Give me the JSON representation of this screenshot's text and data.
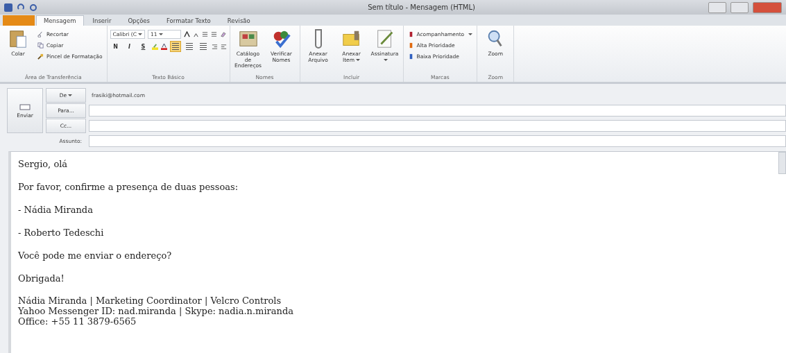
{
  "window": {
    "title": "Sem título - Mensagem (HTML)"
  },
  "tabs": [
    {
      "label": "Mensagem",
      "selected": true
    },
    {
      "label": "Inserir",
      "selected": false
    },
    {
      "label": "Opções",
      "selected": false
    },
    {
      "label": "Formatar Texto",
      "selected": false
    },
    {
      "label": "Revisão",
      "selected": false
    }
  ],
  "ribbon": [
    {
      "kind": "clipboard",
      "label": "Área de Transferência",
      "large": {
        "label": "Colar"
      },
      "small": [
        {
          "label": "Recortar"
        },
        {
          "label": "Copiar"
        },
        {
          "label": "Pincel de Formatação"
        }
      ]
    },
    {
      "kind": "font",
      "label": "Texto Básico",
      "font_name": "Calibri (C",
      "font_size": "11",
      "styles": [
        "N",
        "I",
        "S"
      ],
      "alignment": [
        {
          "selected": true
        },
        {
          "selected": false
        },
        {
          "selected": false
        }
      ]
    },
    {
      "kind": "large",
      "label": "Nomes",
      "buttons": [
        {
          "label": "Catálogo de Endereços",
          "dropdown": false
        },
        {
          "label": "Verificar Nomes",
          "dropdown": false
        }
      ]
    },
    {
      "kind": "large",
      "label": "Incluir",
      "buttons": [
        {
          "label": "Anexar Arquivo",
          "dropdown": false
        },
        {
          "label": "Anexar Item",
          "dropdown": true
        },
        {
          "label": "Assinatura",
          "dropdown": true
        }
      ]
    },
    {
      "kind": "stack",
      "label": "Marcas",
      "buttons": [
        {
          "label": "Acompanhamento",
          "dropdown": true
        },
        {
          "label": "Alta Prioridade",
          "dropdown": false
        },
        {
          "label": "Baixa Prioridade",
          "dropdown": false
        }
      ]
    },
    {
      "kind": "large",
      "label": "Zoom",
      "buttons": [
        {
          "label": "Zoom",
          "dropdown": false
        }
      ]
    }
  ],
  "header": {
    "send": "Enviar",
    "from_button": "De",
    "from": "frasiki@hotmail.com",
    "to_button": "Para...",
    "cc_button": "Cc...",
    "subject_label": "Assunto:"
  },
  "body": {
    "paragraphs": [
      "Sergio, olá",
      "Por favor, confirme a presença de duas pessoas:",
      "- Nádia Miranda",
      "- Roberto Tedeschi",
      "Você pode me enviar o endereço?",
      "Obrigada!"
    ],
    "signature": [
      "Nádia Miranda | Marketing Coordinator | Velcro Controls",
      "Yahoo Messenger ID: nad.miranda | Skype: nadia.n.miranda",
      "Office: +55 11 3879-6565"
    ]
  }
}
